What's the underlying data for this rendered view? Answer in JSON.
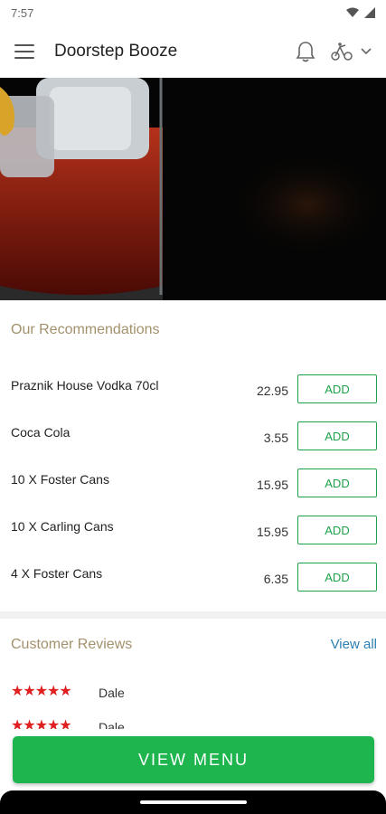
{
  "status": {
    "time": "7:57"
  },
  "app": {
    "title": "Doorstep Booze"
  },
  "recommendations": {
    "title": "Our Recommendations",
    "add_label": "ADD",
    "items": [
      {
        "name": "Praznik House Vodka 70cl",
        "price": "22.95"
      },
      {
        "name": "Coca Cola",
        "price": "3.55"
      },
      {
        "name": "10 X Foster Cans",
        "price": "15.95"
      },
      {
        "name": "10 X Carling Cans",
        "price": "15.95"
      },
      {
        "name": "4 X Foster Cans",
        "price": "6.35"
      }
    ]
  },
  "reviews": {
    "title": "Customer Reviews",
    "view_all": "View all",
    "items": [
      {
        "stars": "★★★★★",
        "rating": 5,
        "name": "Dale"
      },
      {
        "stars": "★★★★★",
        "rating": 5,
        "name": "Dale"
      }
    ]
  },
  "cta": {
    "label": "VIEW MENU"
  },
  "icons": {
    "menu": "hamburger-icon",
    "bell": "bell-icon",
    "delivery": "bikes-icon",
    "dropdown": "chevron-down-icon"
  },
  "colors": {
    "accent": "#1eb54f",
    "section_title": "#a3916c",
    "link": "#2b7fb5",
    "stars": "#e02020"
  }
}
